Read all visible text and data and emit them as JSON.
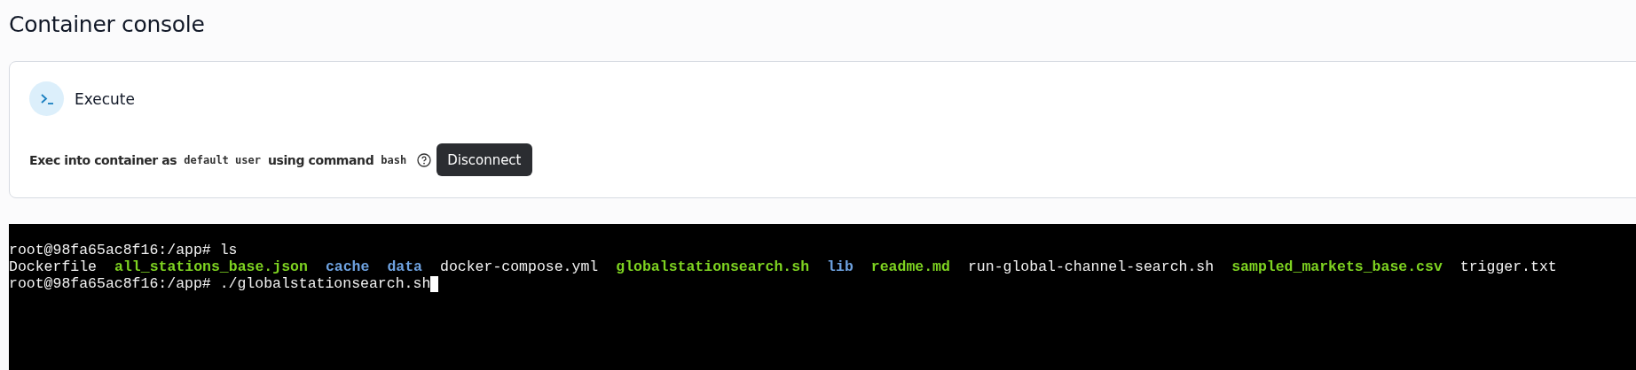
{
  "page": {
    "title": "Container console"
  },
  "card": {
    "heading": "Execute",
    "exec_line": [
      {
        "kind": "label",
        "text": "Exec into container as"
      },
      {
        "kind": "code",
        "text": "default user"
      },
      {
        "kind": "label",
        "text": "using command"
      },
      {
        "kind": "code",
        "text": "bash"
      }
    ],
    "button": "Disconnect"
  },
  "terminal": {
    "lines": [
      {
        "segments": [
          {
            "kind": "plain",
            "text": "root@98fa65ac8f16:/app# ls"
          }
        ],
        "cursor": false
      },
      {
        "segments": [
          {
            "kind": "plain",
            "text": "Dockerfile"
          },
          {
            "kind": "executable",
            "text": "all_stations_base.json"
          },
          {
            "kind": "directory",
            "text": "cache"
          },
          {
            "kind": "directory",
            "text": "data"
          },
          {
            "kind": "plain",
            "text": "docker-compose.yml"
          },
          {
            "kind": "executable",
            "text": "globalstationsearch.sh"
          },
          {
            "kind": "directory",
            "text": "lib"
          },
          {
            "kind": "executable",
            "text": "readme.md"
          },
          {
            "kind": "plain",
            "text": "run-global-channel-search.sh"
          },
          {
            "kind": "executable",
            "text": "sampled_markets_base.csv"
          },
          {
            "kind": "plain",
            "text": "trigger.txt"
          }
        ],
        "cursor": false
      },
      {
        "segments": [
          {
            "kind": "plain",
            "text": "root@98fa65ac8f16:/app# ./globalstationsearch.sh"
          }
        ],
        "cursor": true
      }
    ]
  }
}
